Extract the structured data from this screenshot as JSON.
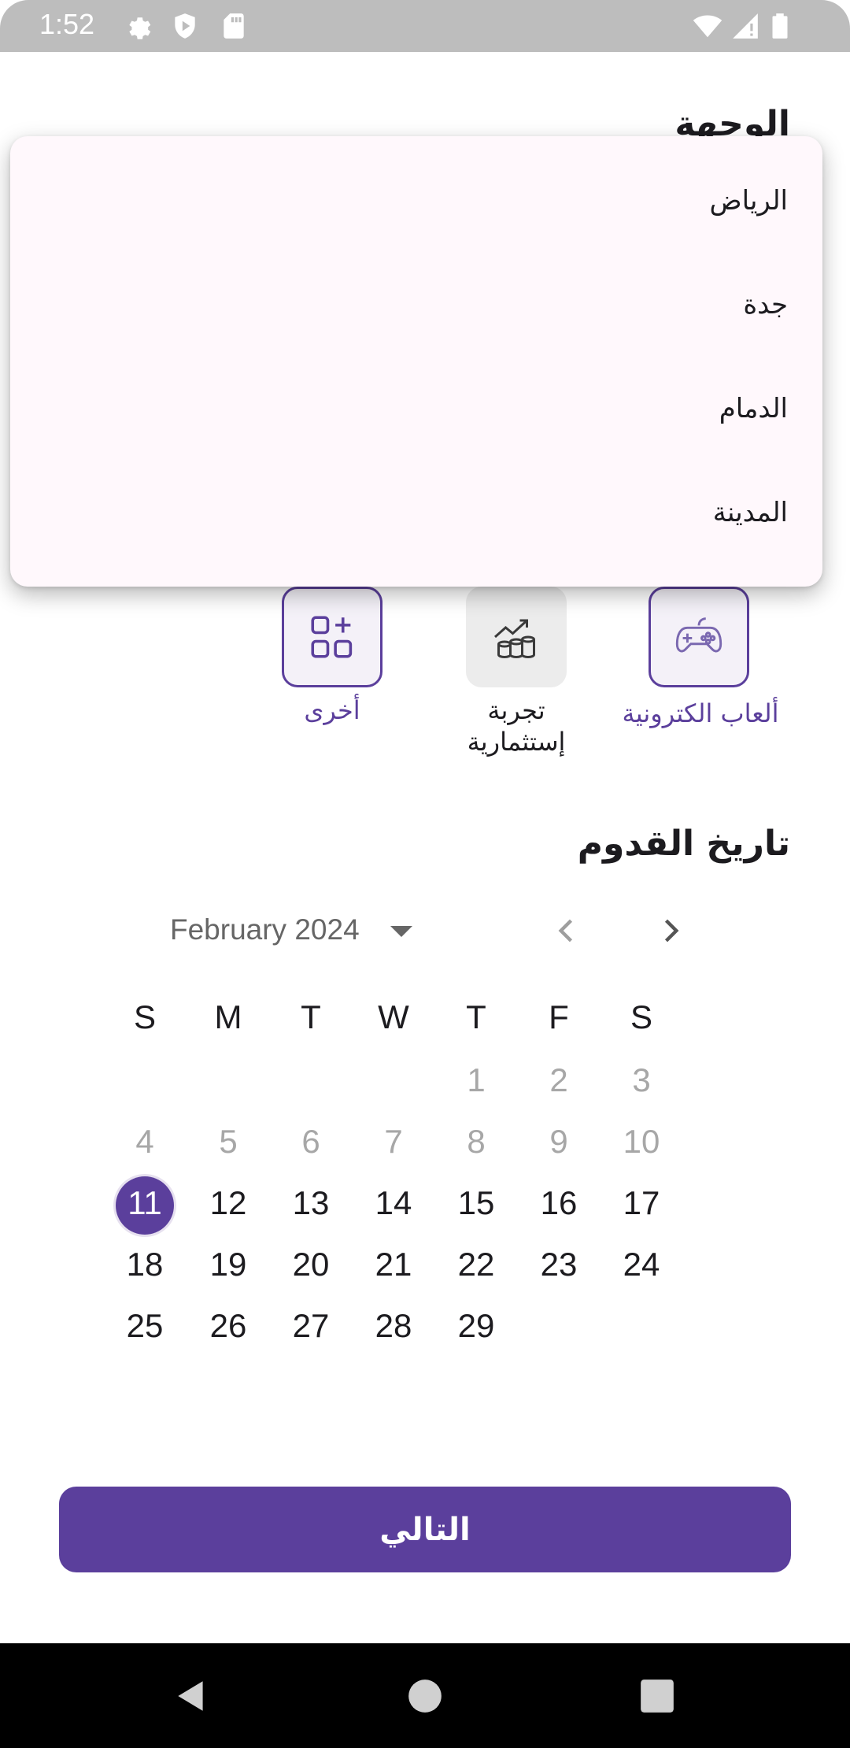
{
  "status_bar": {
    "time": "1:52"
  },
  "destination": {
    "title": "الوجهة",
    "menu_items": [
      "الرياض",
      "جدة",
      "الدمام",
      "المدينة"
    ]
  },
  "categories": [
    {
      "label": "ألعاب الكترونية",
      "icon": "gamepad-icon",
      "selected": true
    },
    {
      "label_line1": "تجربة",
      "label_line2": "إستثمارية",
      "icon": "investment-chart-icon",
      "selected": false
    },
    {
      "label": "أخرى",
      "icon": "add-grid-icon",
      "selected": true
    }
  ],
  "arrival": {
    "title": "تاريخ القدوم",
    "month_label": "February 2024",
    "weekdays": [
      "S",
      "M",
      "T",
      "W",
      "T",
      "F",
      "S"
    ],
    "weeks": [
      [
        "",
        "",
        "",
        "",
        "1",
        "2",
        "3"
      ],
      [
        "4",
        "5",
        "6",
        "7",
        "8",
        "9",
        "10"
      ],
      [
        "11",
        "12",
        "13",
        "14",
        "15",
        "16",
        "17"
      ],
      [
        "18",
        "19",
        "20",
        "21",
        "22",
        "23",
        "24"
      ],
      [
        "25",
        "26",
        "27",
        "28",
        "29",
        "",
        ""
      ]
    ],
    "selected_day": "11",
    "first_enabled_day": 11
  },
  "next_button": {
    "label": "التالي"
  },
  "colors": {
    "accent": "#5b3f9c",
    "menu_bg": "#fff8fc",
    "status_bar": "#bdbdbd"
  }
}
